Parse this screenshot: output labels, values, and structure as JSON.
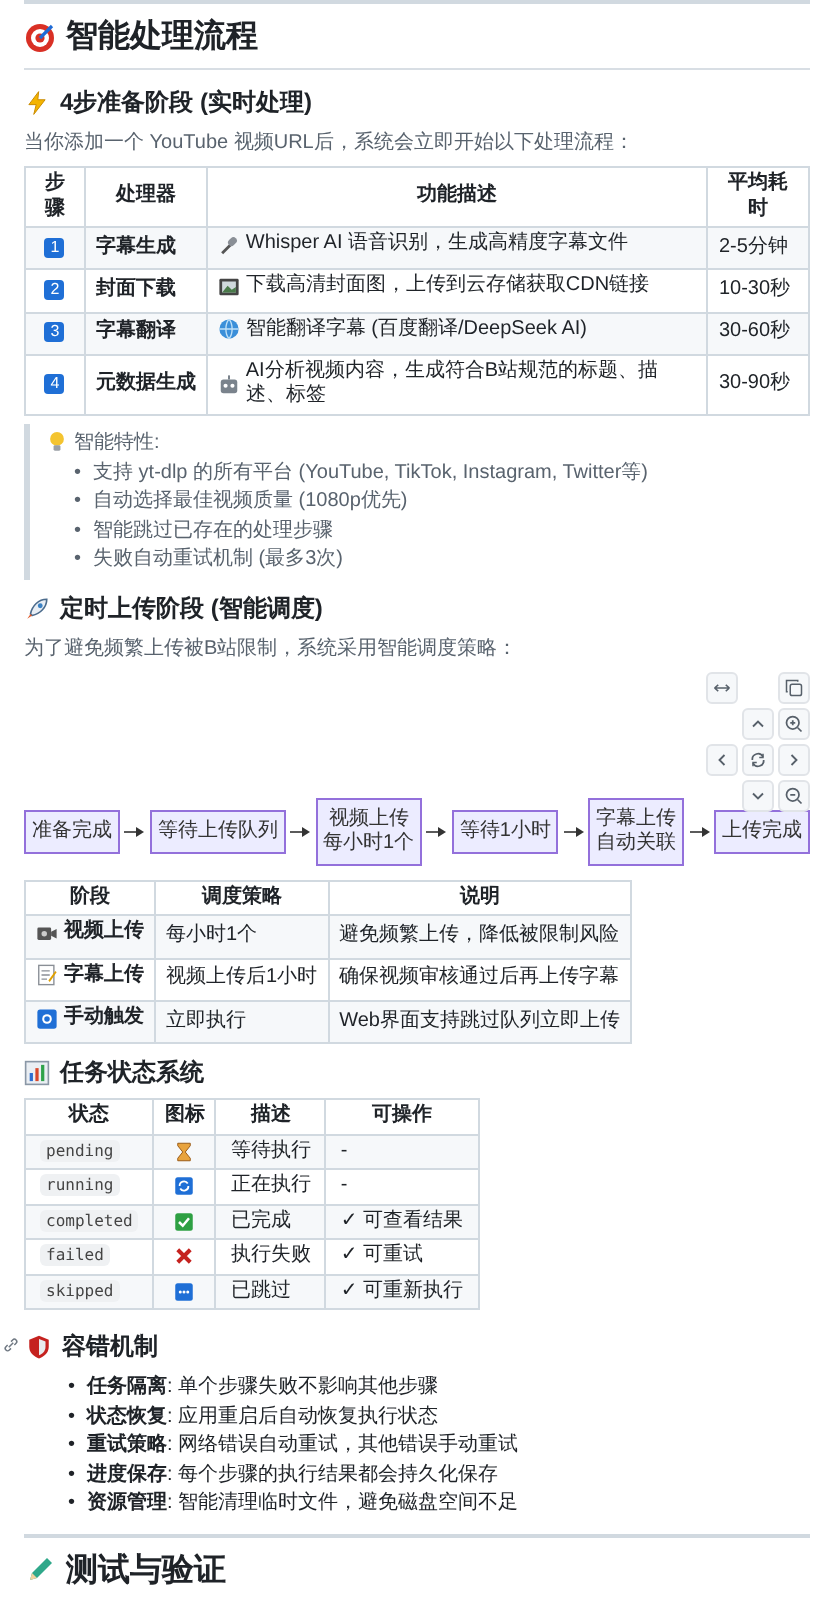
{
  "page_title": "智能处理流程",
  "prep": {
    "heading": "4步准备阶段 (实时处理)",
    "intro": "当你添加一个 YouTube 视频URL后，系统会立即开始以下处理流程：",
    "table": {
      "columns": [
        "步骤",
        "处理器",
        "功能描述",
        "平均耗时"
      ],
      "rows": [
        {
          "step": "1",
          "processor": "字幕生成",
          "description": "Whisper AI 语音识别，生成高精度字幕文件",
          "time": "2-5分钟"
        },
        {
          "step": "2",
          "processor": "封面下载",
          "description": "下载高清封面图，上传到云存储获取CDN链接",
          "time": "10-30秒"
        },
        {
          "step": "3",
          "processor": "字幕翻译",
          "description": "智能翻译字幕 (百度翻译/DeepSeek AI)",
          "time": "30-60秒"
        },
        {
          "step": "4",
          "processor": "元数据生成",
          "description": "AI分析视频内容，生成符合B站规范的标题、描述、标签",
          "time": "30-90秒"
        }
      ]
    },
    "note": {
      "title": "智能特性:",
      "marker": "•",
      "items": [
        "支持 yt-dlp 的所有平台 (YouTube, TikTok, Instagram, Twitter等)",
        "自动选择最佳视频质量 (1080p优先)",
        "智能跳过已存在的处理步骤",
        "失败自动重试机制 (最多3次)"
      ]
    }
  },
  "upload": {
    "heading": "定时上传阶段 (智能调度)",
    "intro": "为了避免频繁上传被B站限制，系统采用智能调度策略：",
    "flow": {
      "nodes": [
        {
          "lines": [
            "准备完成"
          ]
        },
        {
          "lines": [
            "等待上传队列"
          ]
        },
        {
          "lines": [
            "视频上传",
            "每小时1个"
          ]
        },
        {
          "lines": [
            "等待1小时"
          ]
        },
        {
          "lines": [
            "字幕上传",
            "自动关联"
          ]
        },
        {
          "lines": [
            "上传完成"
          ]
        }
      ]
    },
    "table": {
      "columns": [
        "阶段",
        "调度策略",
        "说明"
      ],
      "rows": [
        {
          "stage": "视频上传",
          "strategy": "每小时1个",
          "note": "避免频繁上传，降低被限制风险"
        },
        {
          "stage": "字幕上传",
          "strategy": "视频上传后1小时",
          "note": "确保视频审核通过后再上传字幕"
        },
        {
          "stage": "手动触发",
          "strategy": "立即执行",
          "note": "Web界面支持跳过队列立即上传"
        }
      ]
    }
  },
  "status": {
    "heading": "任务状态系统",
    "table": {
      "columns": [
        "状态",
        "图标",
        "描述",
        "可操作"
      ],
      "rows": [
        {
          "state": "pending",
          "description": "等待执行",
          "action": "-"
        },
        {
          "state": "running",
          "description": "正在执行",
          "action": "-"
        },
        {
          "state": "completed",
          "description": "已完成",
          "action": "✓ 可查看结果"
        },
        {
          "state": "failed",
          "description": "执行失败",
          "action": "✓ 可重试"
        },
        {
          "state": "skipped",
          "description": "已跳过",
          "action": "✓ 可重新执行"
        }
      ]
    }
  },
  "fault": {
    "heading": "容错机制",
    "marker": "•",
    "items": [
      "**任务隔离**: 单个步骤失败不影响其他步骤",
      "**状态恢复**: 应用重启后自动恢复执行状态",
      "**重试策略**: 网络错误自动重试，其他错误手动重试",
      "**进度保存**: 每个步骤的执行结果都会持久化保存",
      "**资源管理**: 智能清理临时文件，避免磁盘空间不足"
    ]
  },
  "next_heading": "测试与验证"
}
